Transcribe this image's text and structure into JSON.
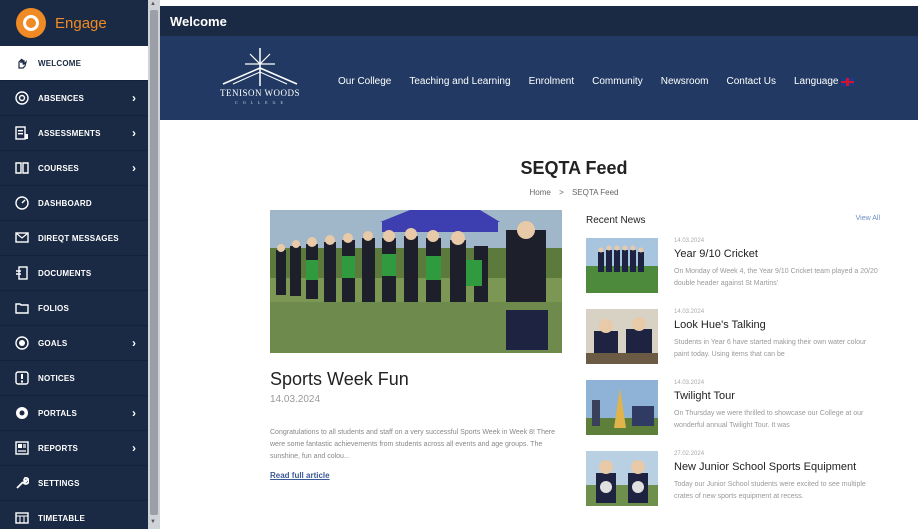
{
  "brand": {
    "name": "Engage",
    "accent": "#f08a24",
    "sidebar_bg": "#1b2a44"
  },
  "sidebar": {
    "items": [
      {
        "label": "Welcome",
        "icon": "hand-wave-icon",
        "active": true,
        "has_submenu": false
      },
      {
        "label": "Absences",
        "icon": "at-sign-icon",
        "active": false,
        "has_submenu": true
      },
      {
        "label": "Assessments",
        "icon": "assessment-icon",
        "active": false,
        "has_submenu": true
      },
      {
        "label": "Courses",
        "icon": "book-open-icon",
        "active": false,
        "has_submenu": true
      },
      {
        "label": "Dashboard",
        "icon": "dashboard-icon",
        "active": false,
        "has_submenu": false
      },
      {
        "label": "DireqT Messages",
        "icon": "message-icon",
        "active": false,
        "has_submenu": false
      },
      {
        "label": "Documents",
        "icon": "document-icon",
        "active": false,
        "has_submenu": false
      },
      {
        "label": "Folios",
        "icon": "folder-icon",
        "active": false,
        "has_submenu": false
      },
      {
        "label": "Goals",
        "icon": "target-icon",
        "active": false,
        "has_submenu": true
      },
      {
        "label": "Notices",
        "icon": "notice-icon",
        "active": false,
        "has_submenu": false
      },
      {
        "label": "Portals",
        "icon": "portal-icon",
        "active": false,
        "has_submenu": true
      },
      {
        "label": "Reports",
        "icon": "report-icon",
        "active": false,
        "has_submenu": true
      },
      {
        "label": "Settings",
        "icon": "wrench-icon",
        "active": false,
        "has_submenu": false
      },
      {
        "label": "Timetable",
        "icon": "calendar-grid-icon",
        "active": false,
        "has_submenu": false
      }
    ]
  },
  "topbar": {
    "title": "Welcome"
  },
  "site": {
    "logo_text": "TENISON WOODS",
    "logo_sub": "C O L L E G E",
    "nav": [
      "Our College",
      "Teaching and Learning",
      "Enrolment",
      "Community",
      "Newsroom",
      "Contact Us",
      "Language"
    ],
    "header_bg": "#223a63"
  },
  "page": {
    "title": "SEQTA Feed",
    "breadcrumb": {
      "home": "Home",
      "sep": ">",
      "current": "SEQTA Feed"
    }
  },
  "feature": {
    "title": "Sports Week Fun",
    "date": "14.03.2024",
    "excerpt": "Congratulations to all students and staff on a very successful Sports Week in Week 8! There were some fantastic achievements from students across all events and age groups. The sunshine, fun and colou...",
    "link": "Read full article"
  },
  "recent": {
    "heading": "Recent News",
    "view_all": "View All",
    "items": [
      {
        "date": "14.03.2024",
        "title": "Year 9/10 Cricket",
        "excerpt": "On Monday of Week 4, the Year 9/10 Cricket team played a 20/20 double header against St Martins'"
      },
      {
        "date": "14.03.2024",
        "title": "Look Hue's Talking",
        "excerpt": "Students in Year 6 have started making their own water colour paint today. Using items that can be"
      },
      {
        "date": "14.03.2024",
        "title": "Twilight Tour",
        "excerpt": "On Thursday we were thrilled to showcase our College at our wonderful annual Twilight Tour. It was"
      },
      {
        "date": "27.02.2024",
        "title": "New Junior School Sports Equipment",
        "excerpt": "Today our Junior School students were excited to see multiple crates of new sports equipment at recess."
      }
    ]
  }
}
